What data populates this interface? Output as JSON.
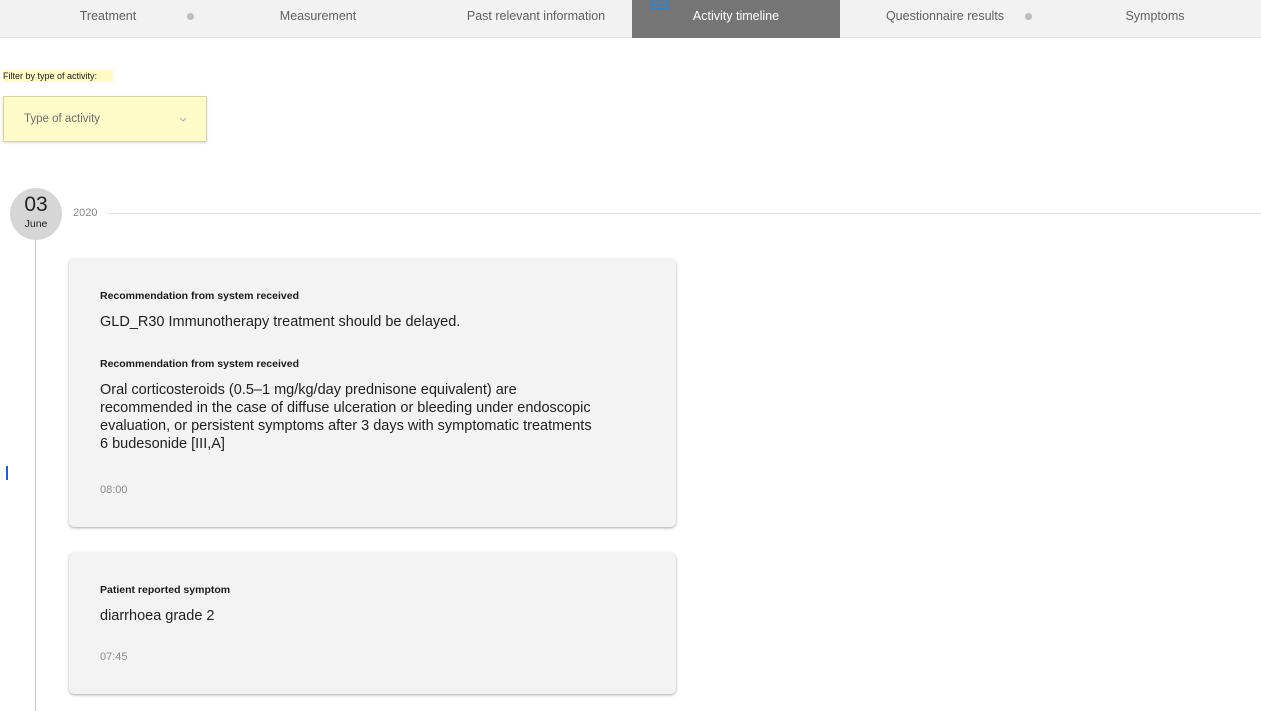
{
  "tabs": [
    {
      "label": "Treatment"
    },
    {
      "label": "Measurement"
    },
    {
      "label": "Past relevant information"
    },
    {
      "label": "Activity timeline",
      "active": true
    },
    {
      "label": "Questionnaire results"
    },
    {
      "label": "Symptoms"
    }
  ],
  "filter": {
    "label": "Filter by type of activity:",
    "select_value": "Type of activity"
  },
  "timeline": {
    "day": "03",
    "month": "June",
    "year": "2020"
  },
  "cards": [
    {
      "entries": [
        {
          "title": "Recommendation from system received",
          "text": "GLD_R30 Immunotherapy treatment should be delayed."
        },
        {
          "title": "Recommendation from system received",
          "text": "Oral corticosteroids (0.5–1 mg/kg/day prednisone equivalent) are recommended in the case of diffuse ulceration or bleeding under endoscopic evaluation, or persistent symptoms after 3 days with symptomatic  treatments 6 budesonide  [III,A]"
        }
      ],
      "time": "08:00"
    },
    {
      "entries": [
        {
          "title": "Patient reported symptom",
          "text": "diarrhoea grade 2"
        }
      ],
      "time": "07:45"
    }
  ],
  "colors": {
    "active_tab": "#757575",
    "filter_highlight": "#fff9c4",
    "card_bg": "#f3f3f3",
    "date_circle": "#d6d6d6"
  }
}
